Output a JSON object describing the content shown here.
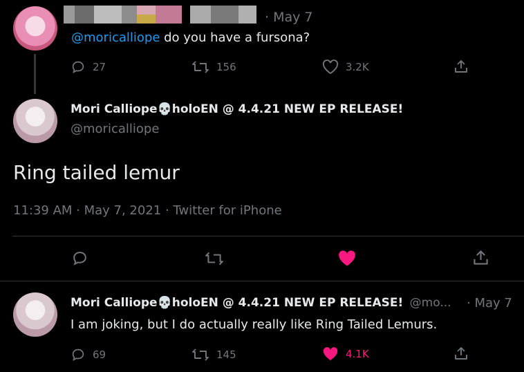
{
  "tweet1": {
    "date": "· May 7",
    "mention": "@moricalliope",
    "text": " do you have a fursona?",
    "replies": "27",
    "retweets": "156",
    "likes": "3.2K"
  },
  "main": {
    "name": "Mori Calliope",
    "name_suffix": "holoEN @ 4.4.21 NEW EP RELEASE!",
    "handle": "@moricalliope",
    "text": "Ring tailed lemur",
    "meta": "11:39 AM · May 7, 2021 · Twitter for iPhone"
  },
  "reply": {
    "name": "Mori Calliope",
    "name_suffix": "holoEN @ 4.4.21 NEW EP RELEASE!",
    "handle": "@mo...",
    "date": "· May 7",
    "text": "I am joking, but I do actually really like Ring Tailed Lemurs.",
    "replies": "69",
    "retweets": "145",
    "likes": "4.1K"
  },
  "colors": {
    "like_active": "#f91880",
    "link": "#1d9bf0",
    "muted": "#71767b"
  },
  "icons": [
    "reply-icon",
    "retweet-icon",
    "like-icon",
    "share-icon",
    "skull-icon"
  ]
}
